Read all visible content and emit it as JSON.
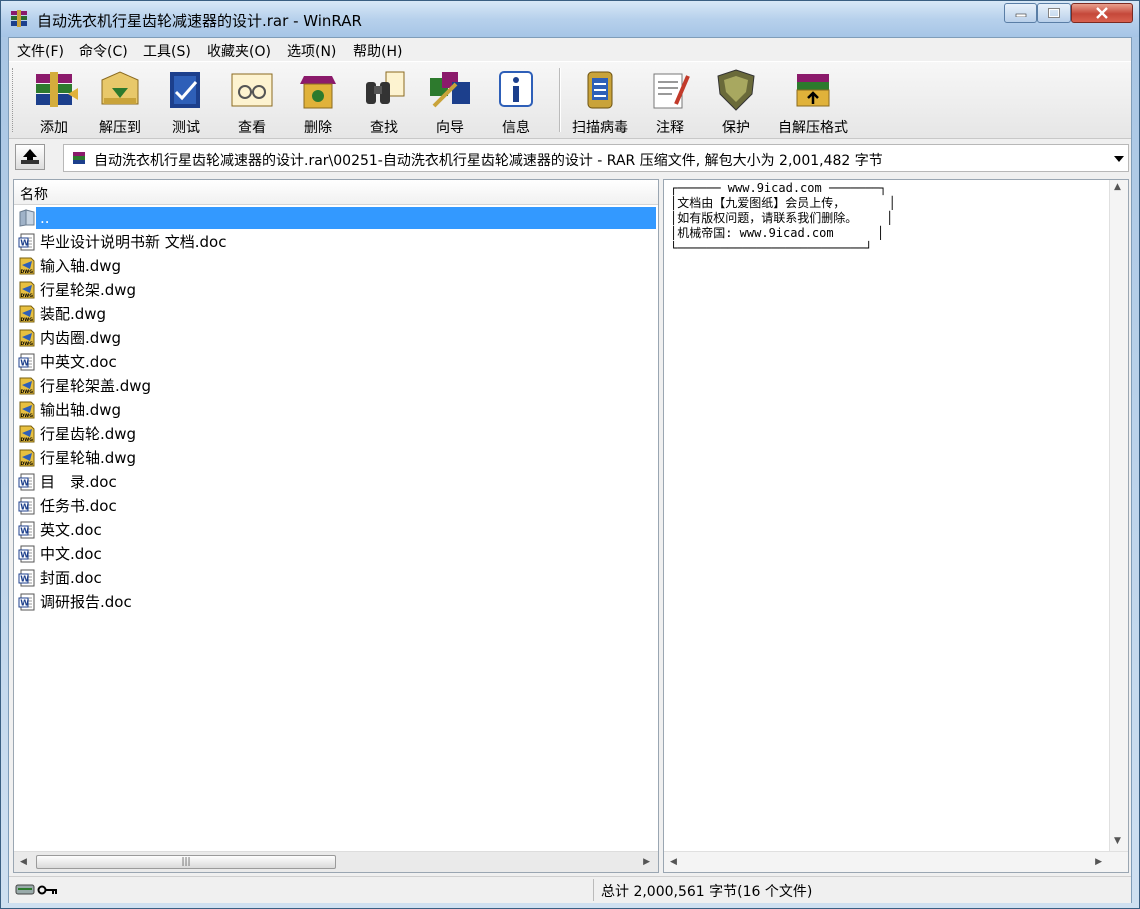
{
  "window": {
    "title": "自动洗衣机行星齿轮减速器的设计.rar - WinRAR"
  },
  "menu": [
    "文件(F)",
    "命令(C)",
    "工具(S)",
    "收藏夹(O)",
    "选项(N)",
    "帮助(H)"
  ],
  "toolbar": [
    {
      "label": "添加",
      "icon": "add-icon"
    },
    {
      "label": "解压到",
      "icon": "extract-icon"
    },
    {
      "label": "测试",
      "icon": "test-icon"
    },
    {
      "label": "查看",
      "icon": "view-icon"
    },
    {
      "label": "删除",
      "icon": "delete-icon"
    },
    {
      "label": "查找",
      "icon": "find-icon"
    },
    {
      "label": "向导",
      "icon": "wizard-icon"
    },
    {
      "label": "信息",
      "icon": "info-icon"
    },
    {
      "label": "扫描病毒",
      "icon": "scan-virus-icon"
    },
    {
      "label": "注释",
      "icon": "comment-icon"
    },
    {
      "label": "保护",
      "icon": "protect-icon"
    },
    {
      "label": "自解压格式",
      "icon": "sfx-icon"
    }
  ],
  "address": {
    "path": "自动洗衣机行星齿轮减速器的设计.rar\\00251-自动洗衣机行星齿轮减速器的设计 - RAR 压缩文件, 解包大小为 2,001,482 字节"
  },
  "filelist": {
    "column_name": "名称",
    "files": [
      {
        "name": "..",
        "type": "up",
        "selected": true
      },
      {
        "name": "毕业设计说明书新 文档.doc",
        "type": "doc"
      },
      {
        "name": "输入轴.dwg",
        "type": "dwg"
      },
      {
        "name": "行星轮架.dwg",
        "type": "dwg"
      },
      {
        "name": "装配.dwg",
        "type": "dwg"
      },
      {
        "name": "内齿圈.dwg",
        "type": "dwg"
      },
      {
        "name": "中英文.doc",
        "type": "doc"
      },
      {
        "name": "行星轮架盖.dwg",
        "type": "dwg"
      },
      {
        "name": "输出轴.dwg",
        "type": "dwg"
      },
      {
        "name": "行星齿轮.dwg",
        "type": "dwg"
      },
      {
        "name": "行星轮轴.dwg",
        "type": "dwg"
      },
      {
        "name": "目　录.doc",
        "type": "doc"
      },
      {
        "name": "任务书.doc",
        "type": "doc"
      },
      {
        "name": "英文.doc",
        "type": "doc"
      },
      {
        "name": "中文.doc",
        "type": "doc"
      },
      {
        "name": "封面.doc",
        "type": "doc"
      },
      {
        "name": "调研报告.doc",
        "type": "doc"
      }
    ]
  },
  "comment": {
    "lines": [
      "┌────── www.9icad.com ───────┐",
      "│文档由【九爱图纸】会员上传，      │",
      "│如有版权问题，请联系我们删除。    │",
      "│机械帝国: www.9icad.com      │",
      "└──────────────────────────┘"
    ]
  },
  "status": {
    "total": "总计 2,000,561 字节(16 个文件)"
  }
}
